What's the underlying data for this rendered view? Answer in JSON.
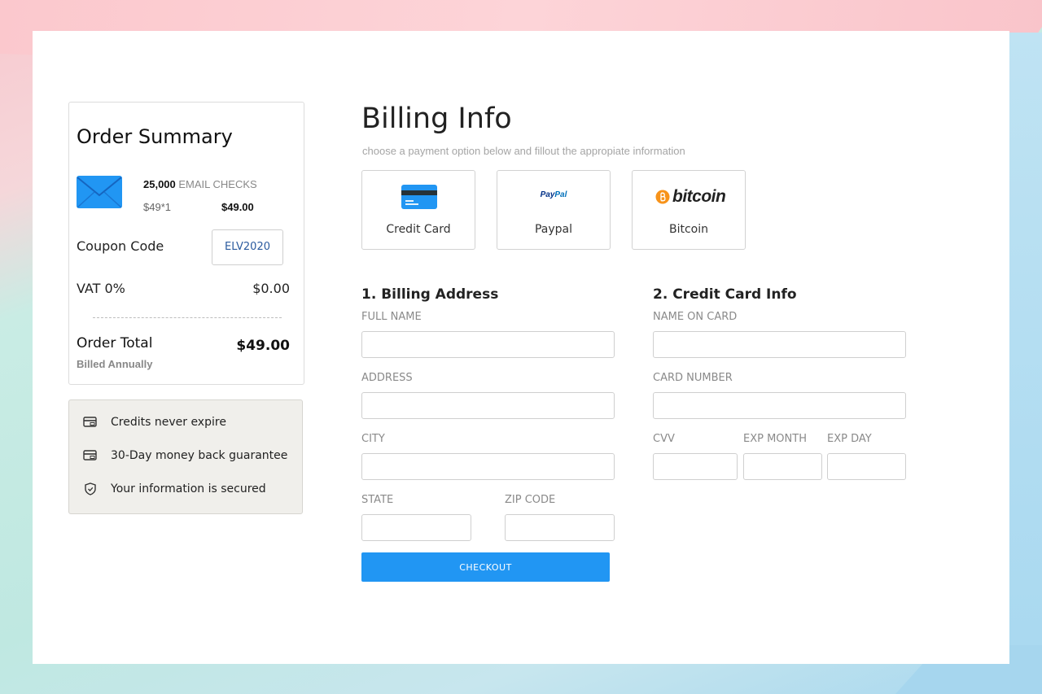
{
  "order_summary": {
    "title": "Order Summary",
    "product": {
      "quantity": "25,000",
      "name": "EMAIL CHECKS",
      "unit_line": "$49*1",
      "price": "$49.00"
    },
    "coupon": {
      "label": "Coupon Code",
      "code": "ELV2020"
    },
    "vat": {
      "label": "VAT 0%",
      "value": "$0.00"
    },
    "total": {
      "label": "Order Total",
      "value": "$49.00",
      "billing_note": "Billed Annually"
    }
  },
  "features": [
    {
      "icon": "credit-card-icon",
      "text": "Credits never expire"
    },
    {
      "icon": "credit-card-icon",
      "text": "30-Day money back guarantee"
    },
    {
      "icon": "shield-icon",
      "text": "Your information is secured"
    }
  ],
  "billing": {
    "title": "Billing Info",
    "subtitle": "choose a payment option below and fillout the appropiate information",
    "payment_options": [
      {
        "label": "Credit Card",
        "icon": "credit-card-icon"
      },
      {
        "label": "Paypal",
        "icon": "paypal-logo",
        "logo_text_a": "Pay",
        "logo_text_b": "Pal"
      },
      {
        "label": "Bitcoin",
        "icon": "bitcoin-logo",
        "logo_text": "bitcoin"
      }
    ],
    "address_section": {
      "title": "1. Billing Address",
      "full_name": {
        "label": "FULL NAME",
        "value": ""
      },
      "address": {
        "label": "ADDRESS",
        "value": ""
      },
      "city": {
        "label": "CITY",
        "value": ""
      },
      "state": {
        "label": "STATE",
        "value": ""
      },
      "zip": {
        "label": "ZIP CODE",
        "value": ""
      }
    },
    "card_section": {
      "title": "2. Credit Card Info",
      "name_on_card": {
        "label": "NAME ON CARD",
        "value": ""
      },
      "card_number": {
        "label": "CARD NUMBER",
        "value": ""
      },
      "cvv": {
        "label": "CVV",
        "value": ""
      },
      "exp_month": {
        "label": "EXP MONTH",
        "value": ""
      },
      "exp_day": {
        "label": "EXP DAY",
        "value": ""
      }
    },
    "checkout_label": "CHECKOUT"
  },
  "colors": {
    "accent": "#2196f3",
    "mail_icon": "#2196f3",
    "coupon_text": "#2a5a9e",
    "bitcoin": "#f7931a"
  }
}
